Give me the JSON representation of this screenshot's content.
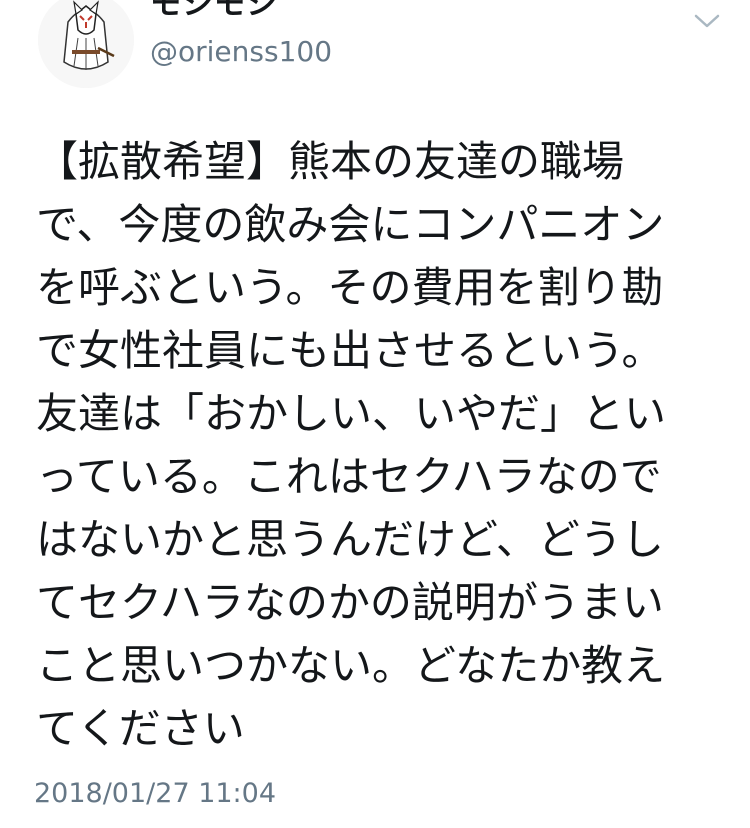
{
  "tweet": {
    "author": {
      "display_name": "モシモシ",
      "handle": "@orienss100",
      "avatar_icon": "kitsune-mask-avatar"
    },
    "menu_icon": "chevron-down-icon",
    "text_lines": [
      "【拡散希望】熊本の友達の職場",
      "で、今度の飲み会にコンパニオン",
      "を呼ぶという。その費用を割り勘",
      "で女性社員にも出させるという。",
      "友達は「おかしい、いやだ」とい",
      "っている。これはセクハラなので",
      "はないかと思うんだけど、どうし",
      "てセクハラなのかの説明がうまい",
      "こと思いつかない。どなたか教え",
      "てください"
    ],
    "timestamp": "2018/01/27 11:04"
  },
  "colors": {
    "text": "#14171a",
    "secondary": "#657786",
    "background": "#ffffff"
  }
}
